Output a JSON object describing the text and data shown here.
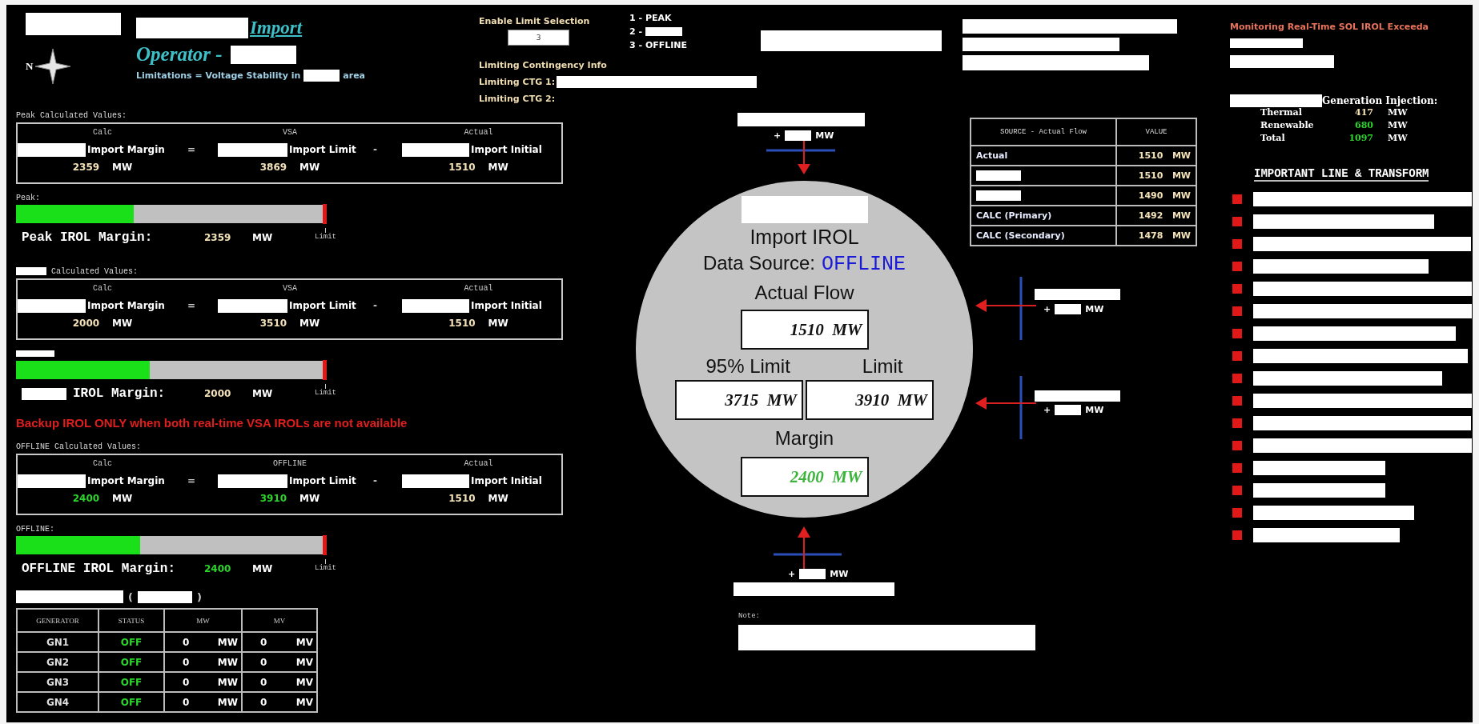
{
  "header": {
    "title": "Import",
    "operator": "Operator -",
    "compass_label": "N",
    "limitations_prefix": "Limitations = Voltage Stability in",
    "limitations_suffix": "area"
  },
  "limit_selection": {
    "label": "Enable Limit Selection",
    "value": "3",
    "options": [
      {
        "text": "1 - PEAK",
        "redacted": false
      },
      {
        "text": "2 -",
        "redacted": true
      },
      {
        "text": "3 - OFFLINE",
        "redacted": false
      }
    ]
  },
  "contingency": {
    "heading": "Limiting Contingency Info",
    "lines": [
      {
        "label": "Limiting CTG 1:",
        "redacted": true
      },
      {
        "label": "Limiting CTG 2:",
        "redacted": false
      }
    ]
  },
  "left_panel": [
    {
      "kind": "values",
      "heading": "Peak Calculated Values:",
      "heading_redacted": false,
      "column_heads": [
        "Calc",
        "VSA",
        "Actual"
      ],
      "terms": [
        "Import Margin",
        "Import Limit",
        "Import Initial"
      ],
      "operators": [
        "=",
        "-"
      ],
      "values": [
        {
          "value": "2359",
          "unit": "MW",
          "highlight": false
        },
        {
          "value": "3869",
          "unit": "MW",
          "highlight": false
        },
        {
          "value": "1510",
          "unit": "MW",
          "highlight": false
        }
      ],
      "bar_label": "Peak:",
      "level": 0.38,
      "limit_label": "Limit",
      "margin": {
        "label": "Peak IROL Margin:",
        "label_redacted": false,
        "value": "2359",
        "unit": "MW",
        "highlight": false
      }
    },
    {
      "kind": "values",
      "heading": "Calculated Values:",
      "heading_redacted": true,
      "column_heads": [
        "Calc",
        "VSA",
        "Actual"
      ],
      "terms": [
        "Import Margin",
        "Import Limit",
        "Import Initial"
      ],
      "operators": [
        "=",
        "-"
      ],
      "values": [
        {
          "value": "2000",
          "unit": "MW",
          "highlight": false
        },
        {
          "value": "3510",
          "unit": "MW",
          "highlight": false
        },
        {
          "value": "1510",
          "unit": "MW",
          "highlight": false
        }
      ],
      "level": 0.43,
      "limit_label": "Limit",
      "margin": {
        "label": "IROL Margin:",
        "label_redacted": true,
        "value": "2000",
        "unit": "MW",
        "highlight": false
      }
    },
    {
      "kind": "warning",
      "text": "Backup IROL ONLY when both real-time VSA IROLs are not available"
    },
    {
      "kind": "values",
      "heading": "OFFLINE Calculated Values:",
      "heading_redacted": false,
      "column_heads": [
        "Calc",
        "OFFLINE",
        "Actual"
      ],
      "terms": [
        "Import Margin",
        "Import Limit",
        "Import Initial"
      ],
      "operators": [
        "=",
        "-"
      ],
      "values": [
        {
          "value": "2400",
          "unit": "MW",
          "highlight": true
        },
        {
          "value": "3910",
          "unit": "MW",
          "highlight": true
        },
        {
          "value": "1510",
          "unit": "MW",
          "highlight": false
        }
      ],
      "bar_label": "OFFLINE:",
      "level": 0.4,
      "limit_label": "Limit",
      "margin": {
        "label": "OFFLINE IROL Margin:",
        "label_redacted": false,
        "value": "2400",
        "unit": "MW",
        "highlight": true
      }
    }
  ],
  "generators": {
    "open": "(",
    "close": ")",
    "columns": [
      "GENERATOR",
      "STATUS",
      "MW",
      "MV"
    ],
    "rows": [
      {
        "name": "GN1",
        "status": "OFF",
        "on": false,
        "mw": "0",
        "mw_unit": "MW",
        "mv": "0",
        "mv_unit": "MV"
      },
      {
        "name": "GN2",
        "status": "OFF",
        "on": false,
        "mw": "0",
        "mw_unit": "MW",
        "mv": "0",
        "mv_unit": "MV"
      },
      {
        "name": "GN3",
        "status": "OFF",
        "on": false,
        "mw": "0",
        "mw_unit": "MW",
        "mv": "0",
        "mv_unit": "MV"
      },
      {
        "name": "GN4",
        "status": "OFF",
        "on": false,
        "mw": "0",
        "mw_unit": "MW",
        "mv": "0",
        "mv_unit": "MV"
      }
    ]
  },
  "diagram": {
    "flows": [
      {
        "kind": "top",
        "sign": "+",
        "unit": "MW"
      },
      {
        "kind": "right",
        "sign": "+",
        "unit": "MW"
      },
      {
        "kind": "right",
        "sign": "+",
        "unit": "MW"
      },
      {
        "kind": "bottom",
        "sign": "+",
        "unit": "MW"
      }
    ],
    "irol": {
      "title": "Import IROL",
      "source_label": "Data Source:",
      "source": "OFFLINE",
      "actual_label": "Actual Flow",
      "actual": {
        "value": "1510",
        "unit": "MW"
      },
      "limits": [
        {
          "label": "95% Limit",
          "value": "3715",
          "unit": "MW"
        },
        {
          "label": "Limit",
          "value": "3910",
          "unit": "MW"
        }
      ],
      "margin_label": "Margin",
      "margin": {
        "value": "2400",
        "unit": "MW",
        "highlight": true
      }
    },
    "note_label": "Note:"
  },
  "source_table": {
    "columns": [
      "SOURCE - Actual Flow",
      "VALUE"
    ],
    "rows": [
      {
        "source": "Actual",
        "value": "1510",
        "unit": "MW"
      },
      {
        "value": "1510",
        "unit": "MW"
      },
      {
        "value": "1490",
        "unit": "MW"
      },
      {
        "source": "CALC (Primary)",
        "value": "1492",
        "unit": "MW"
      },
      {
        "source": "CALC (Secondary)",
        "value": "1478",
        "unit": "MW"
      }
    ]
  },
  "monitoring": {
    "title": "Monitoring Real-Time SOL IROL Exceeda",
    "generation_heading": "Generation Injection:",
    "generation": [
      {
        "label": "Thermal",
        "value": "417",
        "unit": "MW",
        "highlight": false
      },
      {
        "label": "Renewable",
        "value": "680",
        "unit": "MW",
        "highlight": true
      },
      {
        "label": "Total",
        "value": "1097",
        "unit": "MW",
        "highlight": true
      }
    ],
    "important_heading": "IMPORTANT LINE & TRANSFORM",
    "important_items": [
      {
        "kind": "redacted"
      },
      {
        "kind": "redacted"
      },
      {
        "kind": "redacted"
      },
      {
        "kind": "redacted"
      },
      {
        "kind": "redacted"
      },
      {
        "kind": "redacted"
      },
      {
        "kind": "redacted"
      },
      {
        "kind": "redacted"
      },
      {
        "kind": "redacted"
      },
      {
        "kind": "redacted"
      },
      {
        "kind": "redacted"
      },
      {
        "kind": "redacted"
      },
      {
        "kind": "redacted"
      },
      {
        "kind": "redacted"
      },
      {
        "kind": "redacted"
      },
      {
        "kind": "redacted"
      }
    ]
  }
}
